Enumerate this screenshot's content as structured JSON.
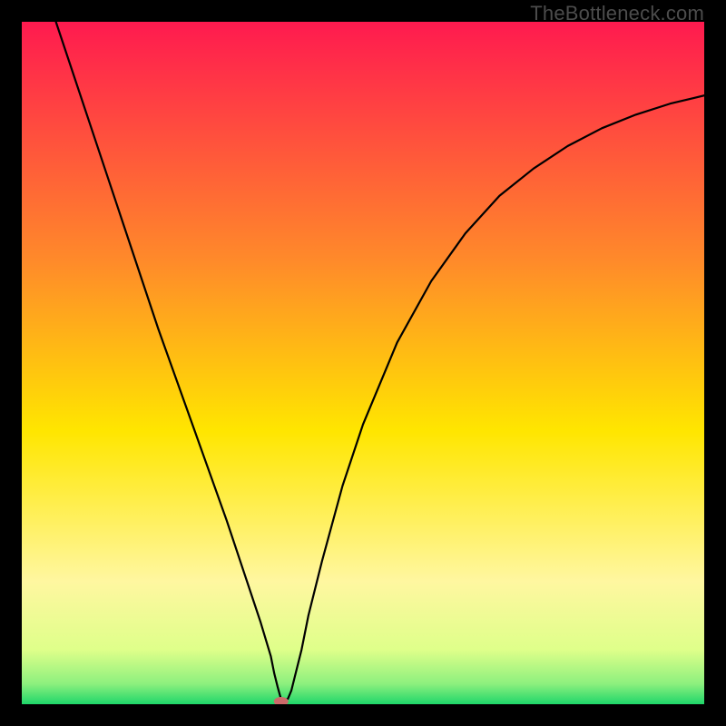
{
  "watermark": "TheBottleneck.com",
  "chart_data": {
    "type": "line",
    "title": "",
    "xlabel": "",
    "ylabel": "",
    "xlim": [
      0,
      100
    ],
    "ylim": [
      0,
      100
    ],
    "grid": false,
    "legend": false,
    "background_gradient": {
      "stops": [
        {
          "pos": 0.0,
          "color": "#ff1a4f"
        },
        {
          "pos": 0.35,
          "color": "#ff8a2a"
        },
        {
          "pos": 0.6,
          "color": "#ffe600"
        },
        {
          "pos": 0.82,
          "color": "#fff7a0"
        },
        {
          "pos": 0.92,
          "color": "#dfff8a"
        },
        {
          "pos": 0.97,
          "color": "#8df07e"
        },
        {
          "pos": 1.0,
          "color": "#1fd66a"
        }
      ]
    },
    "minimum_marker": {
      "x": 38,
      "y": 0,
      "color": "#cc6a6a",
      "rx": 8,
      "ry": 5
    },
    "series": [
      {
        "name": "bottleneck-curve",
        "color": "#000000",
        "width": 2.2,
        "x": [
          5,
          10,
          15,
          20,
          25,
          30,
          33,
          35,
          36.5,
          37,
          37.5,
          38,
          38.5,
          39,
          39.5,
          40,
          41,
          42,
          44,
          47,
          50,
          55,
          60,
          65,
          70,
          75,
          80,
          85,
          90,
          95,
          100
        ],
        "values": [
          100,
          85,
          70,
          55,
          41,
          27,
          18,
          12,
          7,
          4.5,
          2.5,
          0.7,
          0.6,
          0.8,
          2,
          4,
          8,
          13,
          21,
          32,
          41,
          53,
          62,
          69,
          74.5,
          78.5,
          81.8,
          84.4,
          86.4,
          88,
          89.2
        ]
      }
    ]
  }
}
